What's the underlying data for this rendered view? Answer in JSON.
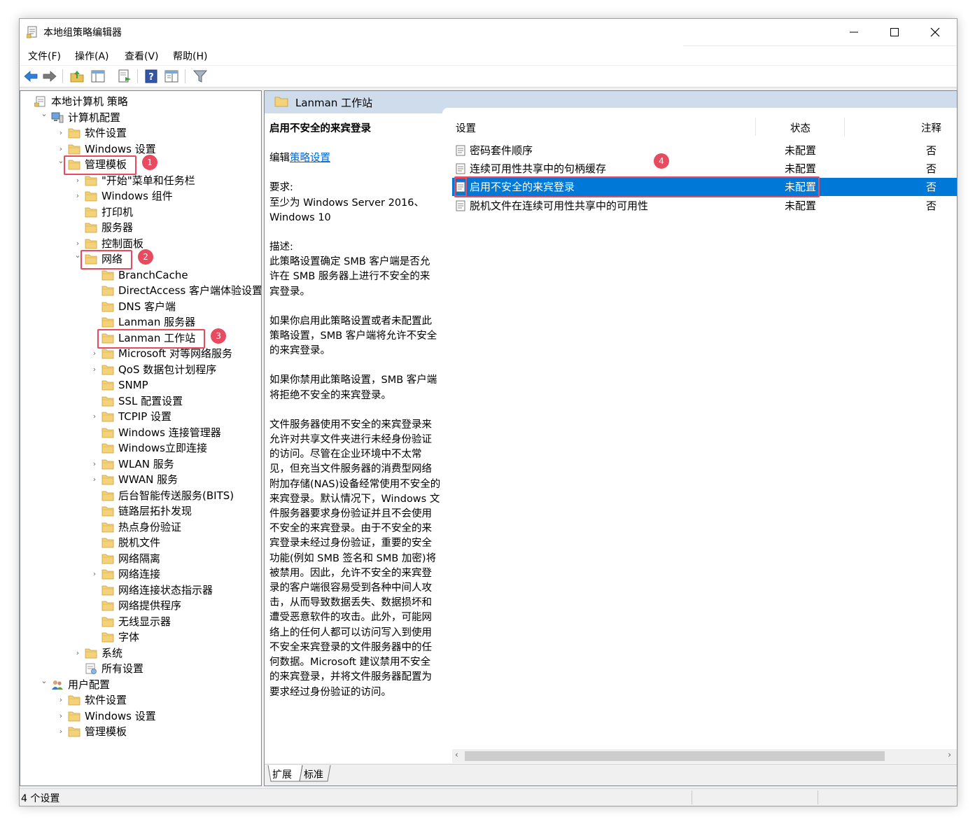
{
  "window": {
    "title": "本地组策略编辑器"
  },
  "menu": [
    "文件(F)",
    "操作(A)",
    "查看(V)",
    "帮助(H)"
  ],
  "toolbar": [
    "back-icon",
    "forward-icon",
    "up-folder-icon",
    "show-hide-tree-icon",
    "export-list-icon",
    "help-icon",
    "properties-view-icon",
    "filter-icon"
  ],
  "tree": [
    {
      "label": "本地计算机 策略",
      "level": 0,
      "expander": "",
      "icon": "policy"
    },
    {
      "label": "计算机配置",
      "level": 1,
      "expander": "open",
      "icon": "computer"
    },
    {
      "label": "软件设置",
      "level": 2,
      "expander": "closed",
      "icon": "folder"
    },
    {
      "label": "Windows 设置",
      "level": 2,
      "expander": "closed",
      "icon": "folder"
    },
    {
      "label": "管理模板",
      "level": 2,
      "expander": "open",
      "icon": "folder"
    },
    {
      "label": "\"开始\"菜单和任务栏",
      "level": 3,
      "expander": "closed",
      "icon": "folder"
    },
    {
      "label": "Windows 组件",
      "level": 3,
      "expander": "closed",
      "icon": "folder"
    },
    {
      "label": "打印机",
      "level": 3,
      "expander": "",
      "icon": "folder"
    },
    {
      "label": "服务器",
      "level": 3,
      "expander": "",
      "icon": "folder"
    },
    {
      "label": "控制面板",
      "level": 3,
      "expander": "closed",
      "icon": "folder"
    },
    {
      "label": "网络",
      "level": 3,
      "expander": "open",
      "icon": "folder"
    },
    {
      "label": "BranchCache",
      "level": 4,
      "expander": "",
      "icon": "folder"
    },
    {
      "label": "DirectAccess 客户端体验设置",
      "level": 4,
      "expander": "",
      "icon": "folder"
    },
    {
      "label": "DNS 客户端",
      "level": 4,
      "expander": "",
      "icon": "folder"
    },
    {
      "label": "Lanman 服务器",
      "level": 4,
      "expander": "",
      "icon": "folder"
    },
    {
      "label": "Lanman 工作站",
      "level": 4,
      "expander": "",
      "icon": "folder",
      "selected": true
    },
    {
      "label": "Microsoft 对等网络服务",
      "level": 4,
      "expander": "closed",
      "icon": "folder"
    },
    {
      "label": "QoS 数据包计划程序",
      "level": 4,
      "expander": "closed",
      "icon": "folder"
    },
    {
      "label": "SNMP",
      "level": 4,
      "expander": "",
      "icon": "folder"
    },
    {
      "label": "SSL 配置设置",
      "level": 4,
      "expander": "",
      "icon": "folder"
    },
    {
      "label": "TCPIP 设置",
      "level": 4,
      "expander": "closed",
      "icon": "folder"
    },
    {
      "label": "Windows 连接管理器",
      "level": 4,
      "expander": "",
      "icon": "folder"
    },
    {
      "label": "Windows立即连接",
      "level": 4,
      "expander": "",
      "icon": "folder"
    },
    {
      "label": "WLAN 服务",
      "level": 4,
      "expander": "closed",
      "icon": "folder"
    },
    {
      "label": "WWAN 服务",
      "level": 4,
      "expander": "closed",
      "icon": "folder"
    },
    {
      "label": "后台智能传送服务(BITS)",
      "level": 4,
      "expander": "",
      "icon": "folder"
    },
    {
      "label": "链路层拓扑发现",
      "level": 4,
      "expander": "",
      "icon": "folder"
    },
    {
      "label": "热点身份验证",
      "level": 4,
      "expander": "",
      "icon": "folder"
    },
    {
      "label": "脱机文件",
      "level": 4,
      "expander": "",
      "icon": "folder"
    },
    {
      "label": "网络隔离",
      "level": 4,
      "expander": "",
      "icon": "folder"
    },
    {
      "label": "网络连接",
      "level": 4,
      "expander": "closed",
      "icon": "folder"
    },
    {
      "label": "网络连接状态指示器",
      "level": 4,
      "expander": "",
      "icon": "folder"
    },
    {
      "label": "网络提供程序",
      "level": 4,
      "expander": "",
      "icon": "folder"
    },
    {
      "label": "无线显示器",
      "level": 4,
      "expander": "",
      "icon": "folder"
    },
    {
      "label": "字体",
      "level": 4,
      "expander": "",
      "icon": "folder"
    },
    {
      "label": "系统",
      "level": 3,
      "expander": "closed",
      "icon": "folder"
    },
    {
      "label": "所有设置",
      "level": 3,
      "expander": "",
      "icon": "settings"
    },
    {
      "label": "用户配置",
      "level": 1,
      "expander": "open",
      "icon": "users"
    },
    {
      "label": "软件设置",
      "level": 2,
      "expander": "closed",
      "icon": "folder"
    },
    {
      "label": "Windows 设置",
      "level": 2,
      "expander": "closed",
      "icon": "folder"
    },
    {
      "label": "管理模板",
      "level": 2,
      "expander": "closed",
      "icon": "folder"
    }
  ],
  "annotations": [
    {
      "number": "1",
      "target_row": 4
    },
    {
      "number": "2",
      "target_row": 10
    },
    {
      "number": "3",
      "target_row": 15
    },
    {
      "number": "4",
      "target_list_row": 2
    }
  ],
  "right": {
    "header_title": "Lanman 工作站",
    "desc": {
      "title": "启用不安全的来宾登录",
      "edit_prefix": "编辑",
      "edit_link": "策略设置",
      "requirements": "要求:\n至少为 Windows Server 2016、\nWindows 10",
      "description_label": "描述:",
      "p1": "此策略设置确定 SMB 客户端是否允\n许在 SMB 服务器上进行不安全的来\n宾登录。",
      "p2": "如果你启用此策略设置或者未配置此\n策略设置，SMB 客户端将允许不安全\n的来宾登录。",
      "p3": "如果你禁用此策略设置，SMB 客户端\n将拒绝不安全的来宾登录。",
      "p4": "文件服务器使用不安全的来宾登录来\n允许对共享文件夹进行未经身份验证\n的访问。尽管在企业环境中不太常\n见，但充当文件服务器的消费型网络\n附加存储(NAS)设备经常使用不安全的\n来宾登录。默认情况下，Windows 文\n件服务器要求身份验证并且不会使用\n不安全的来宾登录。由于不安全的来\n宾登录未经过身份验证，重要的安全\n功能(例如 SMB 签名和 SMB 加密)将\n被禁用。因此，允许不安全的来宾登\n录的客户端很容易受到各种中间人攻\n击，从而导致数据丢失、数据损坏和\n遭受恶意软件的攻击。此外，可能网\n络上的任何人都可以访问写入到使用\n不安全来宾登录的文件服务器中的任\n何数据。Microsoft 建议禁用不安全\n的来宾登录，并将文件服务器配置为\n要求经过身份验证的访问。"
    },
    "columns": [
      "设置",
      "状态",
      "注释"
    ],
    "rows": [
      {
        "name": "密码套件顺序",
        "state": "未配置",
        "comment": "否"
      },
      {
        "name": "连续可用性共享中的句柄缓存",
        "state": "未配置",
        "comment": "否"
      },
      {
        "name": "启用不安全的来宾登录",
        "state": "未配置",
        "comment": "否",
        "selected": true
      },
      {
        "name": "脱机文件在连续可用性共享中的可用性",
        "state": "未配置",
        "comment": "否"
      }
    ],
    "tabs": [
      "扩展",
      "标准"
    ]
  },
  "status": {
    "text": "4 个设置"
  },
  "colors": {
    "selection": "#0078d7",
    "annotation": "#e84a5f",
    "header": "#cfdcec",
    "link": "#0066cc"
  }
}
